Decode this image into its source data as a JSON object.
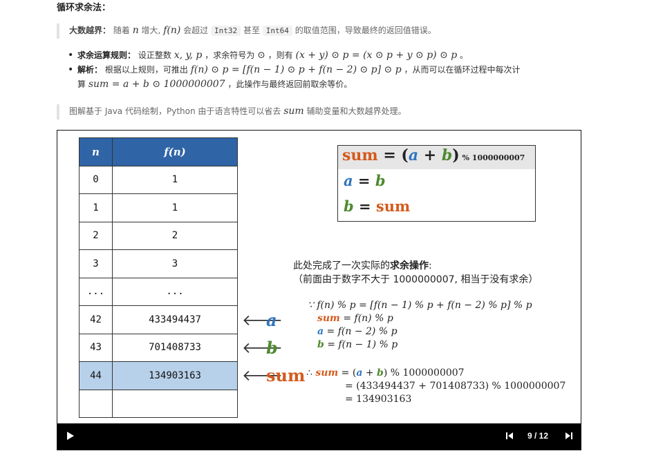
{
  "heading": "循环求余法：",
  "note1": {
    "bold": "大数越界：",
    "t1": "随着",
    "var_n": "n",
    "t2": "增大,",
    "fn": "f(n)",
    "t3": "会超过",
    "code1": "Int32",
    "t4": "甚至",
    "code2": "Int64",
    "t5": "的取值范围，导致最终的返回值错误。"
  },
  "bullets": [
    {
      "bold": "求余运算规则：",
      "t1": "设正整数",
      "m1": "x, y, p",
      "t2": "，求余符号为",
      "m2": "⊙",
      "t3": "，则有",
      "m3": "(x + y) ⊙ p = (x ⊙ p + y ⊙ p) ⊙ p",
      "t4": "。"
    },
    {
      "bold": "解析：",
      "t1": "根据以上规则，可推出",
      "m1": "f(n) ⊙ p = [f(n − 1) ⊙ p + f(n − 2) ⊙ p] ⊙ p",
      "t2": "，从而可以在循环过程中每次计",
      "t3": "算",
      "m2": "sum = a + b ⊙ 1000000007",
      "t4": "，此操作与最终返回前取余等价。"
    }
  ],
  "note2": {
    "t1": "图解基于 Java 代码绘制，Python 由于语言特性可以省去",
    "m1": "sum",
    "t2": "辅助变量和大数越界处理。"
  },
  "slide": {
    "table": {
      "headers": [
        "n",
        "f(n)"
      ],
      "rows": [
        [
          "0",
          "1"
        ],
        [
          "1",
          "1"
        ],
        [
          "2",
          "2"
        ],
        [
          "3",
          "3"
        ],
        [
          "...",
          "..."
        ],
        [
          "42",
          "433494437"
        ],
        [
          "43",
          "701408733"
        ],
        [
          "44",
          "134903163"
        ],
        [
          "",
          ""
        ]
      ],
      "highlight_row": 7
    },
    "arrow_glyph": "🡐",
    "labels": {
      "a": "a",
      "b": "b",
      "sum": "sum"
    },
    "formula_box": {
      "line1_sum": "sum",
      "line1_eq": " = (",
      "line1_a": "a",
      "line1_plus": " + ",
      "line1_b": "b",
      "line1_close": ")",
      "line1_mod": " % 1000000007",
      "line2_a": "a",
      "line2_eq": " = ",
      "line2_b": "b",
      "line3_b": "b",
      "line3_eq": " = ",
      "line3_sum": "sum"
    },
    "desc": {
      "t1": "此处完成了一次实际的",
      "bold": "求余操作",
      "t2": ":",
      "line2": "（前面由于数字不大于 1000000007,   相当于没有求余）"
    },
    "eq1": {
      "line1": "∵ f(n) % p = [f(n − 1) % p + f(n − 2) % p] % p",
      "l2_var": "sum",
      "l2_rest": " = f(n) % p",
      "l3_var": "a",
      "l3_rest": " = f(n − 2) % p",
      "l4_var": "b",
      "l4_rest": " = f(n − 1) % p"
    },
    "eq2": {
      "prefix": "∴ ",
      "l1_sum": "sum",
      "l1_a": "a",
      "l1_b": "b",
      "l1_pre": " = (",
      "l1_plus": " + ",
      "l1_post": ") % 1000000007",
      "line2": "= (433494437 + 701408733) % 1000000007",
      "line3": "= 134903163"
    },
    "player": {
      "counter": "9 / 12"
    }
  }
}
